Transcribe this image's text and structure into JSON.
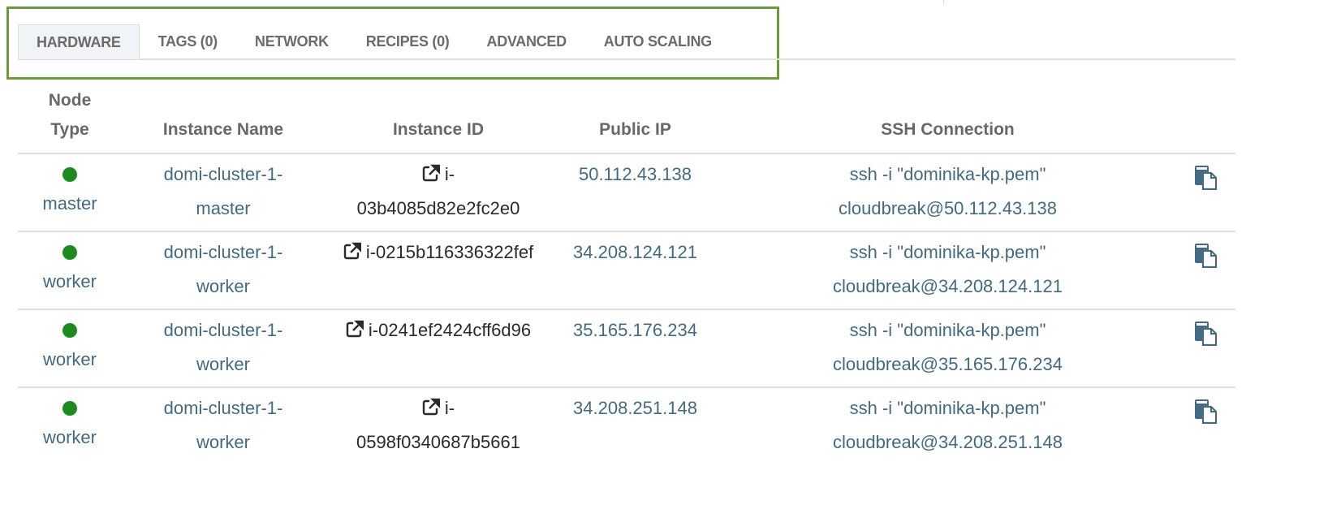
{
  "tabs": [
    {
      "label": "HARDWARE",
      "active": true
    },
    {
      "label": "TAGS (0)"
    },
    {
      "label": "NETWORK"
    },
    {
      "label": "RECIPES (0)"
    },
    {
      "label": "ADVANCED"
    },
    {
      "label": "AUTO SCALING"
    }
  ],
  "table": {
    "headers": {
      "node_type": "Node Type",
      "instance_name": "Instance Name",
      "instance_id": "Instance ID",
      "public_ip": "Public IP",
      "ssh": "SSH Connection"
    },
    "rows": [
      {
        "node_type": "master",
        "instance_name": "domi-cluster-1-master",
        "instance_id": "i-03b4085d82e2fc2e0",
        "public_ip": "50.112.43.138",
        "ssh": "ssh -i \"dominika-kp.pem\" cloudbreak@50.112.43.138",
        "status_color": "#1f8a1f"
      },
      {
        "node_type": "worker",
        "instance_name": "domi-cluster-1-worker",
        "instance_id": "i-0215b116336322fef",
        "public_ip": "34.208.124.121",
        "ssh": "ssh -i \"dominika-kp.pem\" cloudbreak@34.208.124.121",
        "status_color": "#1f8a1f"
      },
      {
        "node_type": "worker",
        "instance_name": "domi-cluster-1-worker",
        "instance_id": "i-0241ef2424cff6d96",
        "public_ip": "35.165.176.234",
        "ssh": "ssh -i \"dominika-kp.pem\" cloudbreak@35.165.176.234",
        "status_color": "#1f8a1f"
      },
      {
        "node_type": "worker",
        "instance_name": "domi-cluster-1-worker",
        "instance_id": "i-0598f0340687b5661",
        "public_ip": "34.208.251.148",
        "ssh": "ssh -i \"dominika-kp.pem\" cloudbreak@34.208.251.148",
        "status_color": "#1f8a1f"
      }
    ]
  },
  "colors": {
    "highlight": "#6a9b3b",
    "link": "#426a80",
    "status_ok": "#1f8a1f"
  }
}
